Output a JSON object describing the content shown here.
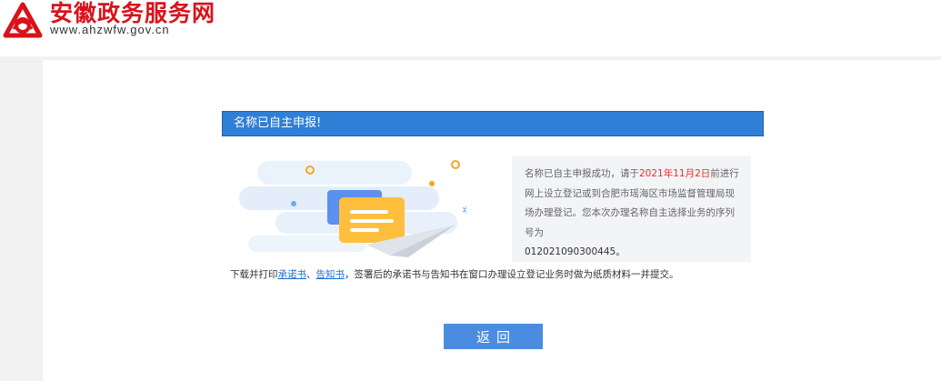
{
  "header": {
    "site_title": "安徽政务服务网",
    "site_url": "www.ahzwfw.gov.cn",
    "brand_color": "#d9121a",
    "logo_icon": "anhui-gov-logo-icon"
  },
  "result": {
    "title": "名称已自主申报!",
    "bar_color": "#2f7fd6"
  },
  "info": {
    "text_before_date": "名称已自主申报成功，请于",
    "deadline": "2021年11月2日",
    "text_after_date": "前进行网上设立登记或到合肥市瑶海区市场监督管理局现场办理登记。您本次办理名称自主选择业务的序列号为",
    "serial_number": "012021090300445",
    "end_punct": "。",
    "highlight_color": "#e8302a"
  },
  "notice": {
    "prefix": "下载并打印",
    "link_commitment": "承诺书",
    "separator": "、",
    "link_notification": "告知书",
    "suffix": "，签署后的承诺书与告知书在窗口办理设立登记业务时做为纸质材料一并提交。"
  },
  "actions": {
    "back_label": "返回"
  },
  "illustration": {
    "icon": "document-airplane-icon"
  }
}
